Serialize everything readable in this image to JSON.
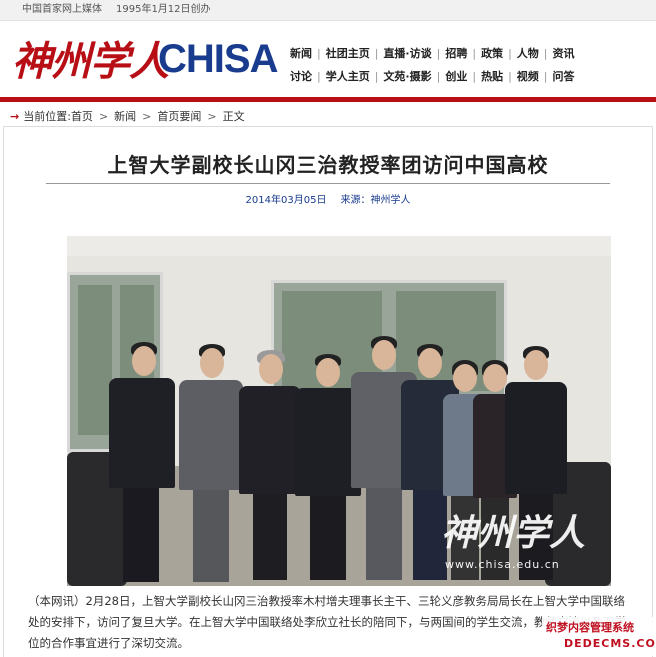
{
  "topbar": {
    "slogan": "中国首家网上媒体",
    "founded": "1995年1月12日创办"
  },
  "header": {
    "logo_cn": "神州学人",
    "logo_en": "CHISA",
    "nav_row1": [
      "新闻",
      "社团主页",
      "直播·访谈",
      "招聘",
      "政策",
      "人物",
      "资讯"
    ],
    "nav_row2": [
      "讨论",
      "学人主页",
      "文苑·摄影",
      "创业",
      "热贴",
      "视频",
      "问答"
    ]
  },
  "breadcrumb": {
    "label": "当前位置:",
    "items": [
      "首页",
      "新闻",
      "首页要闻",
      "正文"
    ]
  },
  "article": {
    "title": "上智大学副校长山冈三治教授率团访问中国高校",
    "date": "2014年03月05日",
    "source": "来源：神州学人",
    "photo": {
      "watermark_cn": "神州学人",
      "watermark_url": "www.chisa.edu.cn"
    },
    "paragraphs": [
      "（本网讯）2月28日，上智大学副校长山冈三治教授率木村增夫理事长主干、三轮义彦教务局局长在上智大学中国联络处的安排下，访问了复旦大学。在上智大学中国联络处李欣立社长的陪同下，与两国间的学生交流，教师交流以及双学位的合作事宜进行了深切交流。"
    ]
  },
  "corner_badge": {
    "text_cn": "织梦内容管理系统",
    "text_en": "DEDECMS.COM"
  },
  "colors": {
    "brand_red": "#b80f16",
    "brand_blue": "#1a3c8e"
  }
}
